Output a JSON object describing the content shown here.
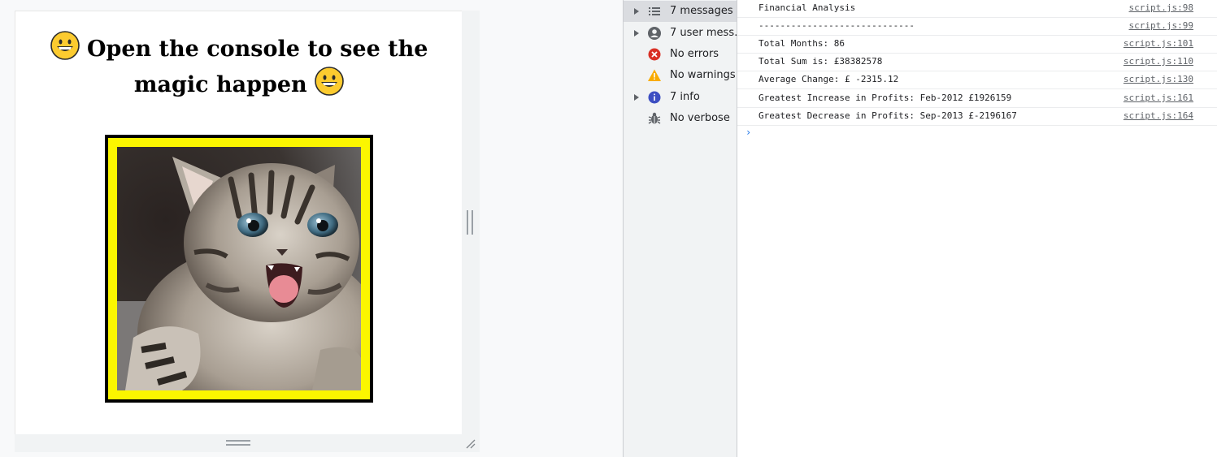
{
  "preview": {
    "heading_text": "Open the console to see the magic happen",
    "emoji_icon": "grinning-face-emoji",
    "image_description": "kitten-photo",
    "frame_color": "#fbf600"
  },
  "devtools": {
    "sidebar": {
      "items": [
        {
          "label": "7 messages",
          "icon": "list-icon",
          "selected": true
        },
        {
          "label": "7 user mess…",
          "icon": "user-icon"
        },
        {
          "label": "No errors",
          "icon": "error-icon"
        },
        {
          "label": "No warnings",
          "icon": "warning-icon"
        },
        {
          "label": "7 info",
          "icon": "info-icon"
        },
        {
          "label": "No verbose",
          "icon": "bug-icon"
        }
      ]
    },
    "console": {
      "messages": [
        {
          "text": "Financial Analysis",
          "source": "script.js:98"
        },
        {
          "text": "-----------------------------",
          "source": "script.js:99"
        },
        {
          "text": "Total Months: 86",
          "source": "script.js:101"
        },
        {
          "text": "Total Sum is: £38382578",
          "source": "script.js:110"
        },
        {
          "text": "Average Change: £ -2315.12",
          "source": "script.js:130"
        },
        {
          "text": "Greatest Increase in Profits: Feb-2012 £1926159",
          "source": "script.js:161"
        },
        {
          "text": "Greatest Decrease in Profits: Sep-2013 £-2196167",
          "source": "script.js:164"
        }
      ],
      "prompt_symbol": "›"
    }
  }
}
